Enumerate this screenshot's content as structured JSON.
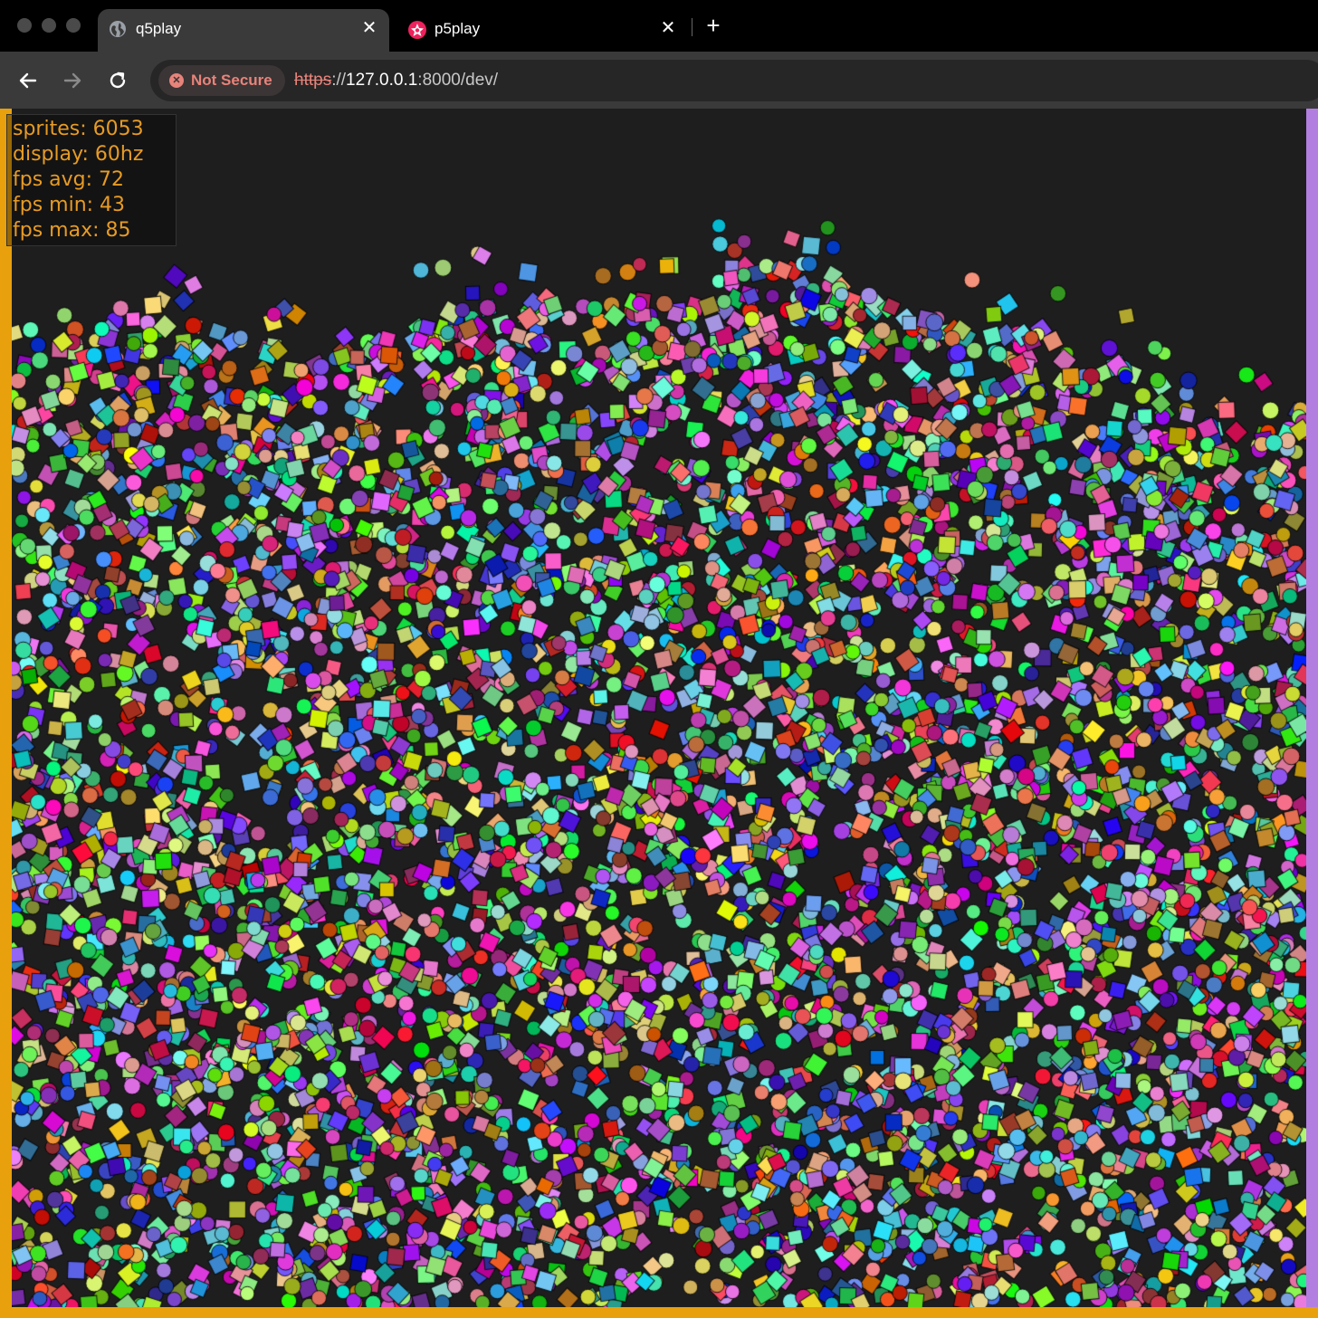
{
  "browser": {
    "tabs": [
      {
        "title": "q5play",
        "icon": "globe-icon",
        "active": true
      },
      {
        "title": "p5play",
        "icon": "p5play-logo-icon",
        "active": false
      }
    ],
    "address": {
      "security_label": "Not Secure",
      "url_scheme": "https",
      "url_sep": "://",
      "url_host": "127.0.0.1",
      "url_rest": ":8000/dev/"
    }
  },
  "stats": {
    "sprites": "sprites: 6053",
    "display": "display: 60hz",
    "fps_avg": "fps avg: 72",
    "fps_min": "fps min: 43",
    "fps_max": "fps max: 85"
  },
  "scene": {
    "sprite_count": 6053,
    "shapes": [
      "circle",
      "square"
    ],
    "background_color": "#1e1e1e",
    "wall_left_color": "#e8a00c",
    "wall_right_color": "#b27fe0",
    "floor_color": "#e8a00c",
    "stats_text_color": "#e79b24"
  }
}
